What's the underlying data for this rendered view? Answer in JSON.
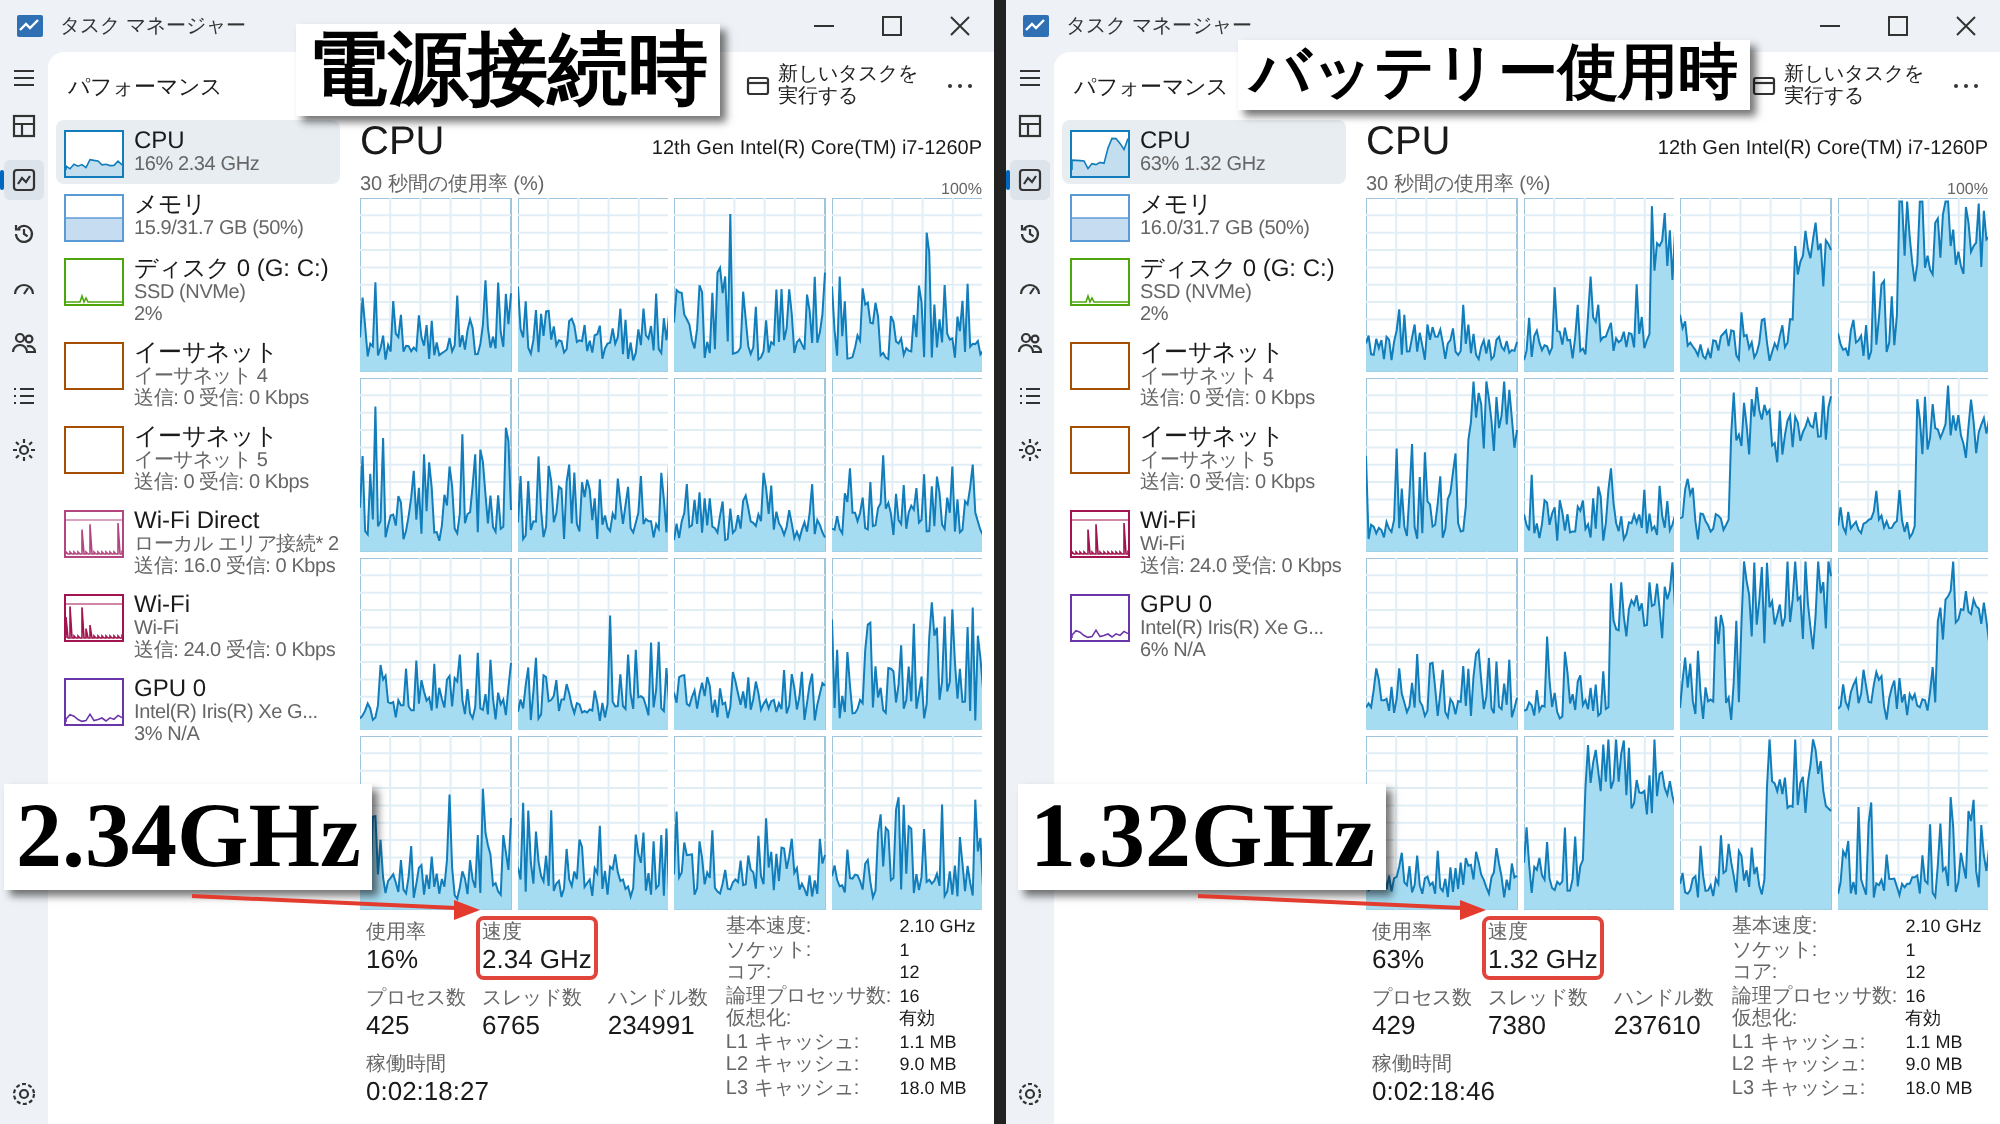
{
  "panels": [
    {
      "window": {
        "title": "タスク マネージャー"
      },
      "nav": [
        {
          "selected": false
        },
        {
          "selected": true
        },
        {
          "selected": false
        },
        {
          "selected": false
        },
        {
          "selected": false
        },
        {
          "selected": false
        },
        {
          "selected": false
        }
      ],
      "sidebar": {
        "title": "パフォーマンス",
        "items": [
          {
            "name": "CPU",
            "lines": [
              "16% 2.34 GHz"
            ],
            "kind": "cpu",
            "color": "#117dbb",
            "selected": true
          },
          {
            "name": "メモリ",
            "lines": [
              "15.9/31.7 GB (50%)"
            ],
            "kind": "memory",
            "color": "#5b9bd5",
            "selected": false
          },
          {
            "name": "ディスク 0 (G: C:)",
            "lines": [
              "SSD (NVMe)",
              "2%"
            ],
            "kind": "disk",
            "color": "#4da60c",
            "selected": false
          },
          {
            "name": "イーサネット",
            "lines": [
              "イーサネット 4",
              "送信: 0 受信: 0 Kbps"
            ],
            "kind": "ethernet",
            "color": "#a74f01",
            "selected": false
          },
          {
            "name": "イーサネット",
            "lines": [
              "イーサネット 5",
              "送信: 0 受信: 0 Kbps"
            ],
            "kind": "ethernet",
            "color": "#a74f01",
            "selected": false
          },
          {
            "name": "Wi-Fi Direct",
            "lines": [
              "ローカル エリア接続* 2",
              "送信: 16.0 受信: 0 Kbps"
            ],
            "kind": "wifi",
            "color": "#b3467e",
            "selected": false
          },
          {
            "name": "Wi-Fi",
            "lines": [
              "Wi-Fi",
              "送信: 24.0 受信: 0 Kbps"
            ],
            "kind": "wifi",
            "color": "#a2134f",
            "selected": false
          },
          {
            "name": "GPU 0",
            "lines": [
              "Intel(R) Iris(R) Xe G...",
              "3% N/A"
            ],
            "kind": "gpu",
            "color": "#6a35a8",
            "selected": false
          }
        ]
      },
      "toolbar": {
        "run_task": "新しいタスクを実行する"
      },
      "main": {
        "title": "CPU",
        "model": "12th Gen Intel(R) Core(TM) i7-1260P",
        "graph_label": "30 秒間の使用率 (%)",
        "graph_max": "100%",
        "stat_rows": [
          [
            {
              "label": "使用率",
              "value": "16%",
              "highlighted": false
            },
            {
              "label": "速度",
              "value": "2.34 GHz",
              "highlighted": true
            }
          ],
          [
            {
              "label": "プロセス数",
              "value": "425",
              "highlighted": false
            },
            {
              "label": "スレッド数",
              "value": "6765",
              "highlighted": false
            },
            {
              "label": "ハンドル数",
              "value": "234991",
              "highlighted": false
            }
          ],
          [
            {
              "label": "稼働時間",
              "value": "0:02:18:27",
              "highlighted": false
            }
          ]
        ],
        "specs": [
          {
            "label": "基本速度:",
            "value": "2.10 GHz"
          },
          {
            "label": "ソケット:",
            "value": "1"
          },
          {
            "label": "コア:",
            "value": "12"
          },
          {
            "label": "論理プロセッサ数:",
            "value": "16"
          },
          {
            "label": "仮想化:",
            "value": "有効"
          },
          {
            "label": "L1 キャッシュ:",
            "value": "1.1 MB"
          },
          {
            "label": "L2 キャッシュ:",
            "value": "9.0 MB"
          },
          {
            "label": "L3 キャッシュ:",
            "value": "18.0 MB"
          }
        ]
      },
      "caption": "電源接続時",
      "value_caption": "2.34GHz"
    },
    {
      "window": {
        "title": "タスク マネージャー"
      },
      "nav": [
        {
          "selected": false
        },
        {
          "selected": true
        },
        {
          "selected": false
        },
        {
          "selected": false
        },
        {
          "selected": false
        },
        {
          "selected": false
        },
        {
          "selected": false
        }
      ],
      "sidebar": {
        "title": "パフォーマンス",
        "items": [
          {
            "name": "CPU",
            "lines": [
              "63% 1.32 GHz"
            ],
            "kind": "cpu",
            "color": "#117dbb",
            "selected": true
          },
          {
            "name": "メモリ",
            "lines": [
              "16.0/31.7 GB (50%)"
            ],
            "kind": "memory",
            "color": "#5b9bd5",
            "selected": false
          },
          {
            "name": "ディスク 0 (G: C:)",
            "lines": [
              "SSD (NVMe)",
              "2%"
            ],
            "kind": "disk",
            "color": "#4da60c",
            "selected": false
          },
          {
            "name": "イーサネット",
            "lines": [
              "イーサネット 4",
              "送信: 0 受信: 0 Kbps"
            ],
            "kind": "ethernet",
            "color": "#a74f01",
            "selected": false
          },
          {
            "name": "イーサネット",
            "lines": [
              "イーサネット 5",
              "送信: 0 受信: 0 Kbps"
            ],
            "kind": "ethernet",
            "color": "#a74f01",
            "selected": false
          },
          {
            "name": "Wi-Fi",
            "lines": [
              "Wi-Fi",
              "送信: 24.0 受信: 0 Kbps"
            ],
            "kind": "wifi",
            "color": "#a2134f",
            "selected": false
          },
          {
            "name": "GPU 0",
            "lines": [
              "Intel(R) Iris(R) Xe G...",
              "6% N/A"
            ],
            "kind": "gpu",
            "color": "#6a35a8",
            "selected": false
          }
        ]
      },
      "toolbar": {
        "run_task": "新しいタスクを実行する"
      },
      "main": {
        "title": "CPU",
        "model": "12th Gen Intel(R) Core(TM) i7-1260P",
        "graph_label": "30 秒間の使用率 (%)",
        "graph_max": "100%",
        "stat_rows": [
          [
            {
              "label": "使用率",
              "value": "63%",
              "highlighted": false
            },
            {
              "label": "速度",
              "value": "1.32 GHz",
              "highlighted": true
            }
          ],
          [
            {
              "label": "プロセス数",
              "value": "429",
              "highlighted": false
            },
            {
              "label": "スレッド数",
              "value": "7380",
              "highlighted": false
            },
            {
              "label": "ハンドル数",
              "value": "237610",
              "highlighted": false
            }
          ],
          [
            {
              "label": "稼働時間",
              "value": "0:02:18:46",
              "highlighted": false
            }
          ]
        ],
        "specs": [
          {
            "label": "基本速度:",
            "value": "2.10 GHz"
          },
          {
            "label": "ソケット:",
            "value": "1"
          },
          {
            "label": "コア:",
            "value": "12"
          },
          {
            "label": "論理プロセッサ数:",
            "value": "16"
          },
          {
            "label": "仮想化:",
            "value": "有効"
          },
          {
            "label": "L1 キャッシュ:",
            "value": "1.1 MB"
          },
          {
            "label": "L2 キャッシュ:",
            "value": "9.0 MB"
          },
          {
            "label": "L3 キャッシュ:",
            "value": "18.0 MB"
          }
        ]
      },
      "caption": "バッテリー使用時",
      "value_caption": "1.32GHz"
    }
  ]
}
